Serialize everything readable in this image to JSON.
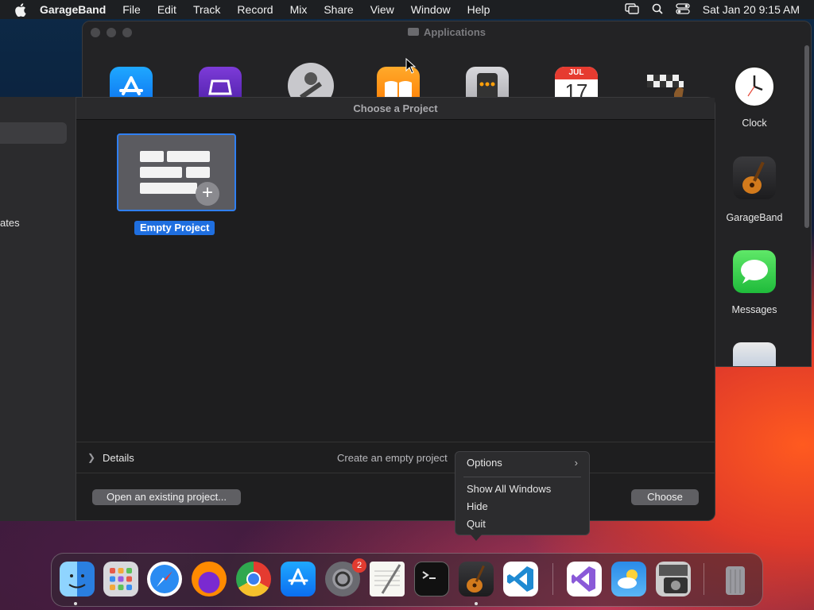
{
  "menubar": {
    "app_name": "GarageBand",
    "items": [
      "File",
      "Edit",
      "Track",
      "Record",
      "Mix",
      "Share",
      "View",
      "Window",
      "Help"
    ],
    "datetime": "Sat Jan 20  9:15 AM",
    "status_icons": [
      "screen-mirroring-icon",
      "search-icon",
      "control-center-icon"
    ]
  },
  "finder": {
    "title": "Applications",
    "calendar": {
      "month": "JUL",
      "day": "17"
    },
    "side_apps": [
      "Clock",
      "GarageBand",
      "Messages"
    ]
  },
  "sidebar": {
    "partial_label": "ates"
  },
  "dialog": {
    "title": "Choose a Project",
    "template_label": "Empty Project",
    "details_label": "Details",
    "description": "Create an empty project",
    "open_existing_label": "Open an existing project...",
    "choose_label": "Choose"
  },
  "context_menu": {
    "items": [
      "Options",
      "Show All Windows",
      "Hide",
      "Quit"
    ]
  },
  "dock": {
    "apps": [
      "Finder",
      "Launchpad",
      "Safari",
      "Firefox",
      "Chrome",
      "App Store",
      "System Settings",
      "TextEdit",
      "Terminal",
      "GarageBand",
      "Visual Studio Code",
      "Visual Studio",
      "Weather",
      "Image Capture",
      "Trash"
    ],
    "settings_badge": "2"
  },
  "colors": {
    "accent": "#1f6fe0",
    "selection_border": "#2f7ff1",
    "badge": "#e23b30"
  }
}
